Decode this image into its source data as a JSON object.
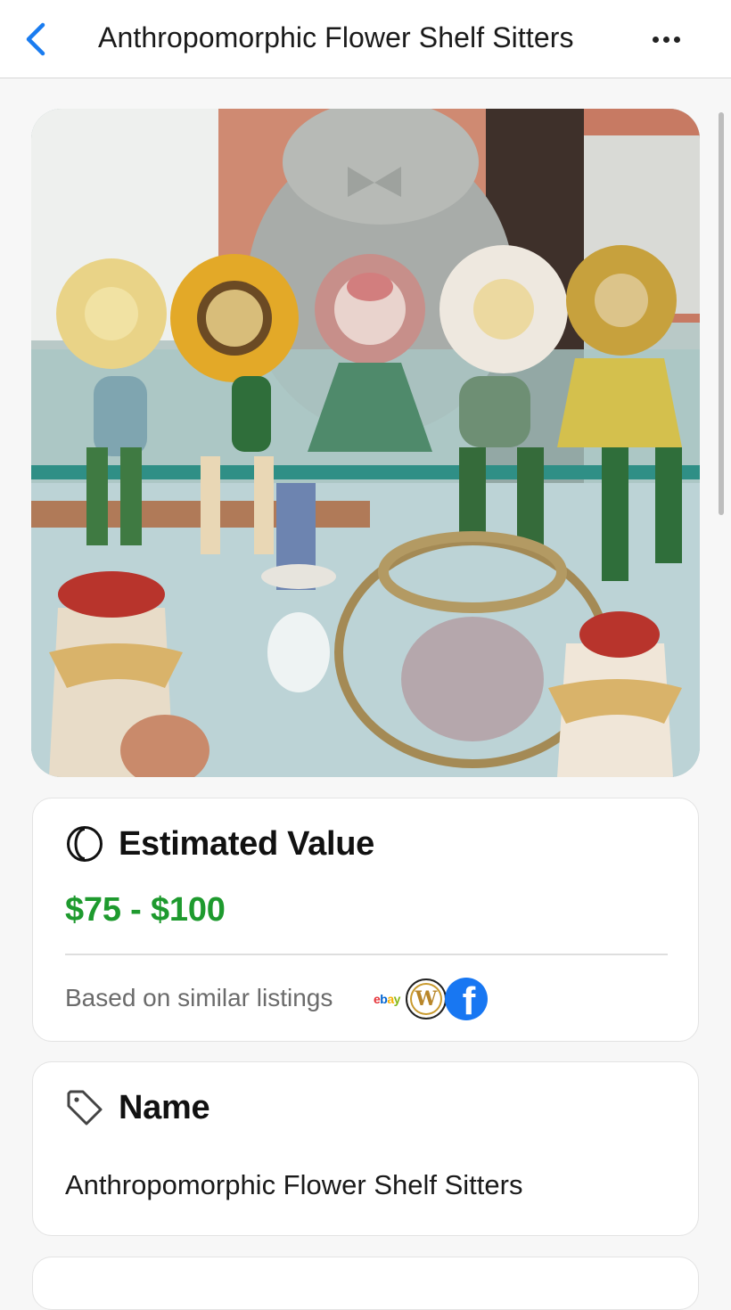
{
  "nav": {
    "title": "Anthropomorphic Flower Shelf Sitters"
  },
  "photo": {
    "subject": "Anthropomorphic Flower Shelf Sitters"
  },
  "estimated_value": {
    "title": "Estimated Value",
    "price_range": "$75 - $100",
    "based_on": "Based on similar listings",
    "sources": [
      "ebay",
      "W",
      "f"
    ],
    "price_color": "#1e9a2e"
  },
  "name_card": {
    "title": "Name",
    "value": "Anthropomorphic Flower Shelf Sitters"
  },
  "colors": {
    "accent": "#1a7cf0",
    "price": "#1e9a2e",
    "facebook": "#1877f2"
  }
}
